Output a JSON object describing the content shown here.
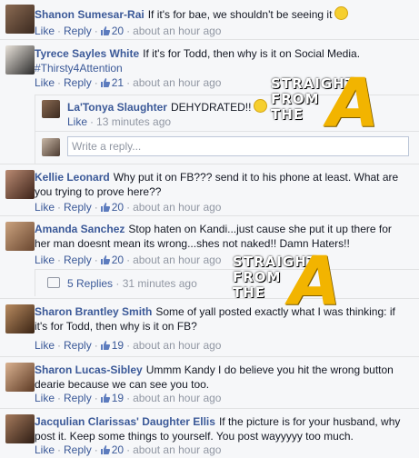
{
  "actions": {
    "like": "Like",
    "reply": "Reply",
    "sep": "·"
  },
  "comments": [
    {
      "name": "Shanon Sumesar-Rai",
      "text": "If it's for bae, we shouldn't be seeing it",
      "likes": "20",
      "time": "about an hour ago",
      "emoji": "smile-emoji"
    },
    {
      "name": "Tyrece Sayles White",
      "text": "If it's for Todd, then why is it on Social Media.",
      "hashtag": "#Thirsty4Attention",
      "likes": "21",
      "time": "about an hour ago"
    },
    {
      "name": "Kellie Leonard",
      "text": "Why put it on FB??? send it to his phone at least. What are you trying to prove here??",
      "likes": "20",
      "time": "about an hour ago"
    },
    {
      "name": "Amanda Sanchez",
      "text": "Stop haten on Kandi...just cause she put it up there for her man doesnt mean its wrong...shes not naked!! Damn Haters!!",
      "likes": "20",
      "time": "about an hour ago"
    },
    {
      "name": "Sharon Brantley Smith",
      "text": "Some of yall posted exactly what I was thinking: if it's for Todd, then why is it on FB?",
      "likes": "19",
      "time": "about an hour ago"
    },
    {
      "name": "Sharon Lucas-Sibley",
      "text": "Ummm Kandy I do believe you hit the wrong button dearie because we can see you too.",
      "likes": "19",
      "time": "about an hour ago"
    },
    {
      "name": "Jacqulian Clarissas' Daughter Ellis",
      "text": "If the picture is for your husband, why post it. Keep some things to yourself. You post wayyyyy too much.",
      "likes": "20",
      "time": "about an hour ago"
    }
  ],
  "reply": {
    "name": "La'Tonya Slaughter",
    "text": "DEHYDRATED!!",
    "emoji": "sad-emoji",
    "time": "13 minutes ago"
  },
  "reply_input": {
    "placeholder": "Write a reply..."
  },
  "more_replies": {
    "label": "5 Replies",
    "time": "31 minutes ago"
  },
  "watermark": {
    "line1": "STRAIGHT",
    "line2": "FROM",
    "line3": "THE",
    "letter": "A"
  }
}
